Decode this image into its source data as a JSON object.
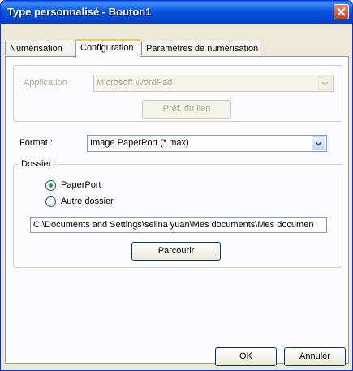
{
  "window": {
    "title": "Type personnalisé - Bouton1"
  },
  "tabs": [
    "Numérisation",
    "Configuration",
    "Paramètres de numérisation"
  ],
  "application": {
    "label": "Application :",
    "value": "Microsoft WordPad",
    "button": "Préf. du lien"
  },
  "format": {
    "label": "Format :",
    "value": "Image PaperPort (*.max)"
  },
  "dossier": {
    "label": "Dossier :",
    "options": [
      "PaperPort",
      "Autre dossier"
    ],
    "selected": "PaperPort",
    "path": "C:\\Documents and Settings\\selina yuan\\Mes documents\\Mes documen",
    "browse": "Parcourir"
  },
  "footer": {
    "ok": "OK",
    "cancel": "Annuler"
  }
}
